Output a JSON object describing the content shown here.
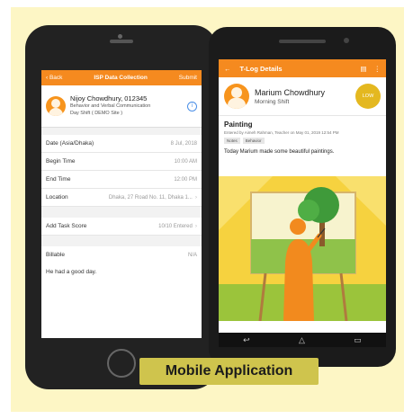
{
  "colors": {
    "accent": "#f58a1f",
    "badge": "#e4b820",
    "caption_bg": "#cfc44d",
    "panel_bg": "#fdf6c5"
  },
  "isp": {
    "back": "‹ Back",
    "title": "ISP Data Collection",
    "submit": "Submit",
    "name": "Nijoy Chowdhury, 012345",
    "sub1": "Behavior and Verbal Communication",
    "sub2": "Day Shift ( DEMO Site )",
    "rows": [
      {
        "label": "Date (Asia/Dhaka)",
        "value": "8 Jul, 2018"
      },
      {
        "label": "Begin Time",
        "value": "10:00 AM"
      },
      {
        "label": "End Time",
        "value": "12:00 PM"
      },
      {
        "label": "Location",
        "value": "Dhaka, 27 Road No. 11, Dhaka 1..."
      }
    ],
    "task_label": "Add Task Score",
    "task_value": "10/10 Entered",
    "billable_label": "Billable",
    "billable_value": "N/A",
    "note": "He had a good day."
  },
  "tlog": {
    "title": "T-Log Details",
    "name": "Marium Chowdhury",
    "shift": "Morning Shift",
    "badge": "LOW",
    "heading": "Painting",
    "entered": "Entered by Aimeh Rahman, Teacher on May 01, 2019 12:54 PM",
    "tags": [
      "Notes",
      "Behavior"
    ],
    "body": "Today Marium made some beautiful paintings."
  },
  "icons": {
    "back": "arrow-left-icon",
    "doc": "document-icon",
    "more": "more-vertical-icon",
    "info": "info-icon"
  },
  "caption": "Mobile Application"
}
